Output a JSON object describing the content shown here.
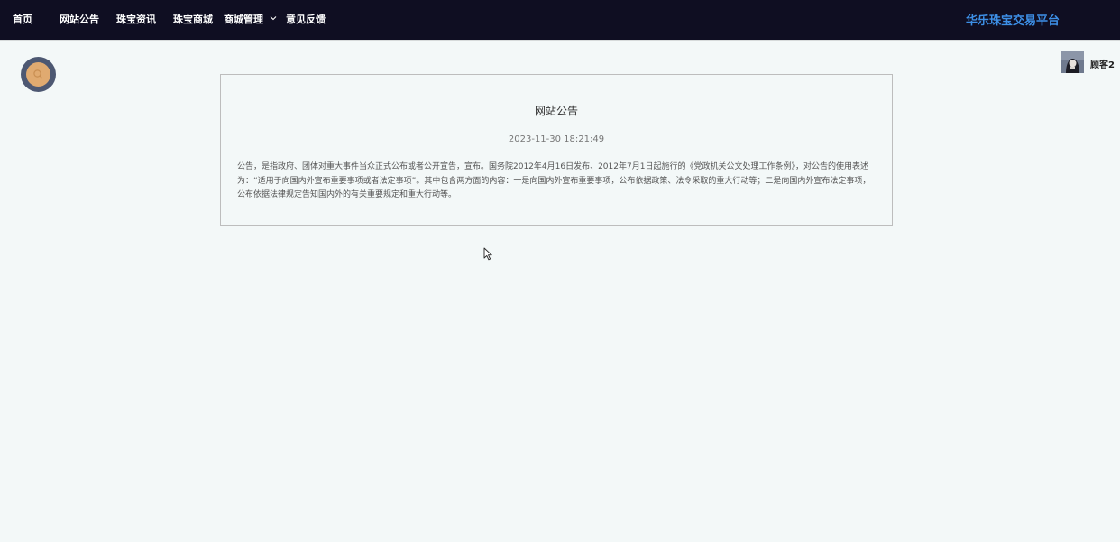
{
  "nav": {
    "items": [
      {
        "label": "首页"
      },
      {
        "label": "网站公告"
      },
      {
        "label": "珠宝资讯"
      },
      {
        "label": "珠宝商城"
      },
      {
        "label": "商城管理",
        "has_dropdown": true
      },
      {
        "label": "意见反馈"
      }
    ],
    "brand": "华乐珠宝交易平台"
  },
  "user": {
    "name": "顾客2",
    "avatar_icon": "avatar-icon"
  },
  "search": {
    "icon": "search-icon"
  },
  "notice": {
    "title": "网站公告",
    "time": "2023-11-30 18:21:49",
    "content": "公告，是指政府、团体对重大事件当众正式公布或者公开宣告，宣布。国务院2012年4月16日发布、2012年7月1日起施行的《党政机关公文处理工作条例》，对公告的使用表述为：“适用于向国内外宣布重要事项或者法定事项”。其中包含两方面的内容：一是向国内外宣布重要事项，公布依据政策、法令采取的重大行动等；二是向国内外宣布法定事项，公布依据法律规定告知国内外的有关重要规定和重大行动等。"
  },
  "colors": {
    "topbar_bg": "#0f0e22",
    "brand": "#3d8fe6",
    "page_bg": "#f3f8f8",
    "search_outer": "#4d5872",
    "search_inner": "#e0aa70"
  }
}
